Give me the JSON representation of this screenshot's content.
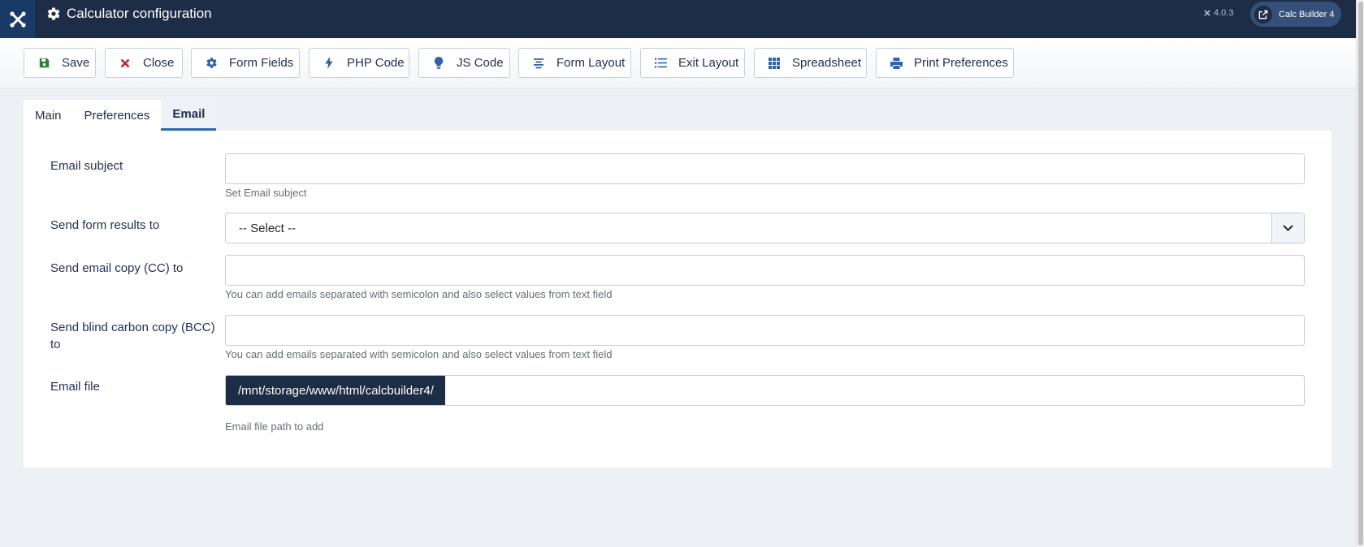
{
  "header": {
    "title": "Calculator configuration",
    "version": "4.0.3",
    "app_button": "Calc Builder 4"
  },
  "toolbar": {
    "buttons": [
      {
        "label": "Save",
        "icon": "save-icon"
      },
      {
        "label": "Close",
        "icon": "close-icon"
      },
      {
        "label": "Form Fields",
        "icon": "gear-icon"
      },
      {
        "label": "PHP Code",
        "icon": "bolt-icon"
      },
      {
        "label": "JS Code",
        "icon": "lightbulb-icon"
      },
      {
        "label": "Form Layout",
        "icon": "align-center-icon"
      },
      {
        "label": "Exit Layout",
        "icon": "list-icon"
      },
      {
        "label": "Spreadsheet",
        "icon": "grid-icon"
      },
      {
        "label": "Print Preferences",
        "icon": "print-icon"
      }
    ]
  },
  "tabs": [
    {
      "label": "Main",
      "active": false
    },
    {
      "label": "Preferences",
      "active": false
    },
    {
      "label": "Email",
      "active": true
    }
  ],
  "form": {
    "email_subject": {
      "label": "Email subject",
      "value": "",
      "hint": "Set Email subject"
    },
    "send_results": {
      "label": "Send form results to",
      "selected": "-- Select --"
    },
    "cc": {
      "label": "Send email copy (CC) to",
      "value": "",
      "hint": "You can add emails separated with semicolon and also select values from text field"
    },
    "bcc": {
      "label_line1": "Send blind carbon copy (BCC)",
      "label_line2": "to",
      "value": "",
      "hint": "You can add emails separated with semicolon and also select values from text field"
    },
    "email_file": {
      "label": "Email file",
      "prefix": "/mnt/storage/www/html/calcbuilder4/",
      "value": "",
      "hint": "Email file path to add"
    }
  },
  "colors": {
    "header_bg": "#1c2d45",
    "accent": "#3068b0",
    "close_red": "#c0262d",
    "save_green": "#2f7d3a"
  }
}
